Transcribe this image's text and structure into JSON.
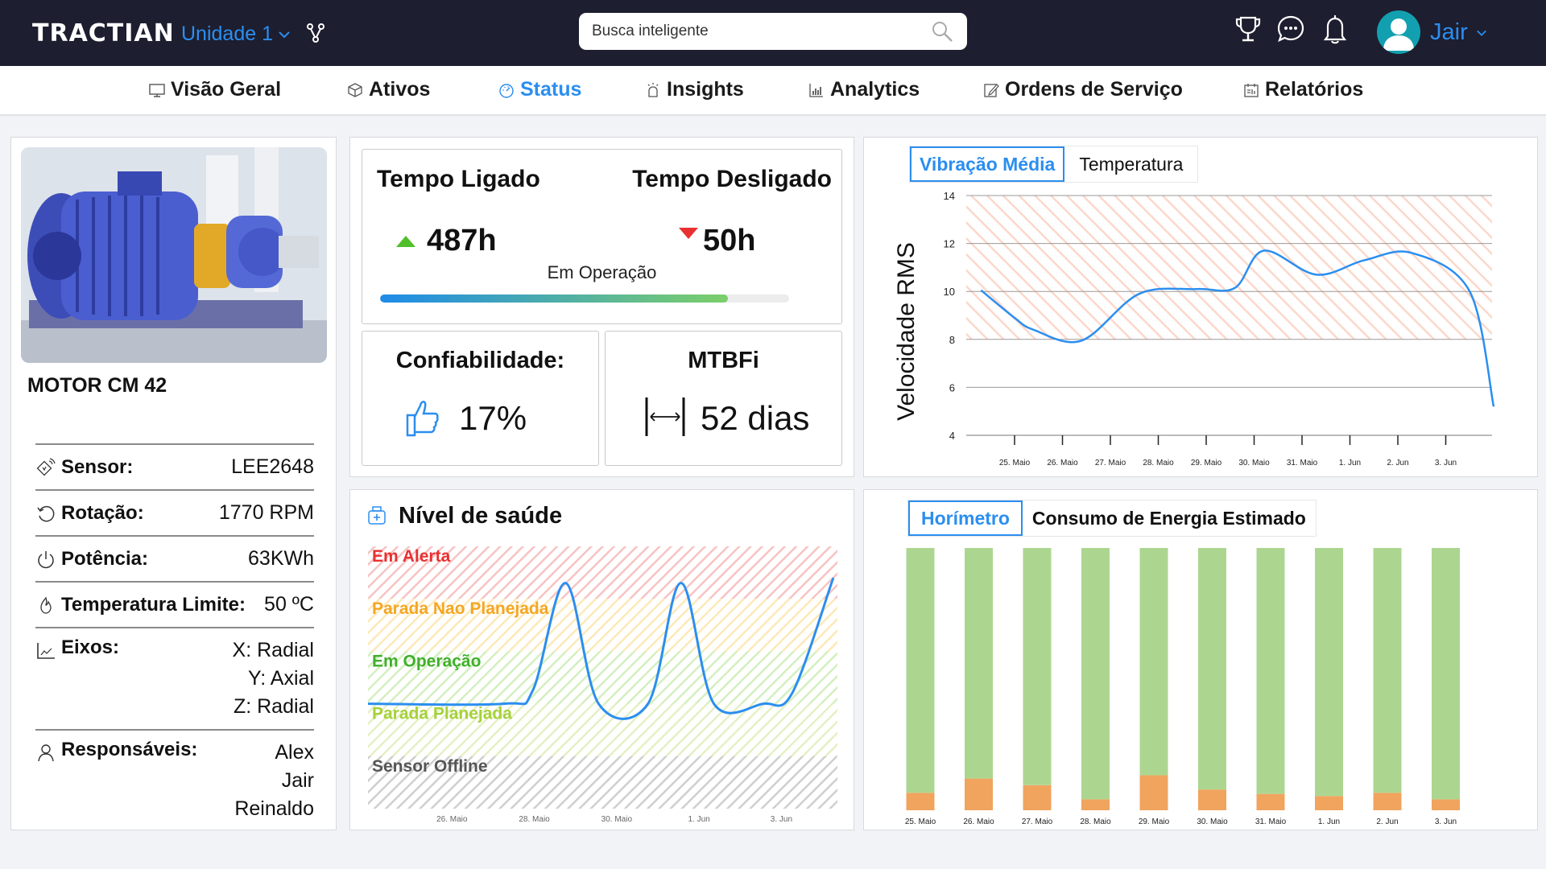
{
  "header": {
    "logo": "TRACTIAN",
    "unit_selector": "Unidade 1",
    "search_placeholder": "Busca inteligente",
    "user_name": "Jair"
  },
  "nav": {
    "items": [
      {
        "label": "Visão Geral",
        "icon": "monitor-icon",
        "active": false
      },
      {
        "label": "Ativos",
        "icon": "cube-icon",
        "active": false
      },
      {
        "label": "Status",
        "icon": "gauge-icon",
        "active": true
      },
      {
        "label": "Insights",
        "icon": "lightbulb-icon",
        "active": false
      },
      {
        "label": "Analytics",
        "icon": "bar-chart-icon",
        "active": false
      },
      {
        "label": "Ordens de Serviço",
        "icon": "edit-icon",
        "active": false
      },
      {
        "label": "Relatórios",
        "icon": "report-icon",
        "active": false
      }
    ]
  },
  "asset": {
    "name": "MOTOR CM 42",
    "specs": [
      {
        "label": "Sensor:",
        "icon": "sensor-icon",
        "values": [
          "LEE2648"
        ]
      },
      {
        "label": "Rotação:",
        "icon": "rotation-icon",
        "values": [
          "1770 RPM"
        ]
      },
      {
        "label": "Potência:",
        "icon": "power-icon",
        "values": [
          "63KWh"
        ]
      },
      {
        "label": "Temperatura Limite:",
        "icon": "flame-icon",
        "values": [
          "50 ºC"
        ]
      },
      {
        "label": "Eixos:",
        "icon": "axis-chart-icon",
        "values": [
          "X: Radial",
          "Y: Axial",
          "Z: Radial"
        ]
      },
      {
        "label": "Responsáveis:",
        "icon": "user-icon",
        "values": [
          "Alex",
          "Jair",
          "Reinaldo"
        ]
      }
    ]
  },
  "uptime": {
    "on_label": "Tempo Ligado",
    "on_value": "487h",
    "off_label": "Tempo Desligado",
    "off_value": "50h",
    "status": "Em Operação",
    "progress_fraction": 0.85,
    "colors": {
      "up": "#4fc02a",
      "down": "#e83131"
    }
  },
  "reliability": {
    "label": "Confiabilidade:",
    "value": "17%"
  },
  "mtbfi": {
    "label": "MTBFi",
    "value": "52 dias"
  },
  "vibration_tabs": [
    {
      "label": "Vibração Média",
      "active": true
    },
    {
      "label": "Temperatura",
      "active": false
    }
  ],
  "health": {
    "title": "Nível de saúde"
  },
  "energy_tabs": [
    {
      "label": "Horímetro",
      "active": true
    },
    {
      "label": "Consumo de Energia Estimado",
      "active": false
    }
  ],
  "chart_data": [
    {
      "type": "line",
      "title": "Vibração Média",
      "ylabel": "Velocidade RMS",
      "xlabel": "",
      "ylim": [
        4,
        14
      ],
      "yticks": [
        4,
        6,
        8,
        10,
        12,
        14
      ],
      "categories": [
        "25. Maio",
        "26. Maio",
        "27. Maio",
        "28. Maio",
        "29. Maio",
        "30. Maio",
        "31. Maio",
        "1. Jun",
        "2. Jun",
        "3. Jun"
      ],
      "alert_band": [
        8,
        14
      ],
      "series": [
        {
          "name": "Vibração Média",
          "color": "#2b8ef0",
          "x": [
            -0.7,
            0.0,
            0.4,
            1.4,
            2.6,
            3.8,
            4.6,
            5.2,
            6.3,
            7.3,
            8.3,
            9.5,
            10.0
          ],
          "values": [
            10.05,
            8.9,
            8.4,
            7.95,
            9.9,
            10.1,
            10.15,
            11.7,
            10.7,
            11.3,
            11.6,
            10.0,
            5.2
          ]
        }
      ],
      "grid": true
    },
    {
      "type": "line",
      "title": "Nível de saúde",
      "categories": [
        "26. Maio",
        "28. Maio",
        "30. Maio",
        "1. Jun",
        "3. Jun"
      ],
      "levels": [
        {
          "name": "Em Alerta",
          "color": "#e83131",
          "band": "#f7c3c3"
        },
        {
          "name": "Parada Nao Planejada",
          "color": "#f5a623",
          "band": "#fde9b8"
        },
        {
          "name": "Em Operação",
          "color": "#3fb02a",
          "band": "#d4efbf"
        },
        {
          "name": "Parada Planejada",
          "color": "#a6d13a",
          "band": "#e4f0c4"
        },
        {
          "name": "Sensor Offline",
          "color": "#555555",
          "band": "#cfcfcf"
        }
      ],
      "series": [
        {
          "name": "Saúde",
          "color": "#2b8ef0",
          "x": [
            24.0,
            27.3,
            28.0,
            28.8,
            29.6,
            30.8,
            31.6,
            32.4,
            33.6,
            34.3,
            35.3
          ],
          "values": [
            2.0,
            2.0,
            2.25,
            4.3,
            2.0,
            2.0,
            4.3,
            2.0,
            2.0,
            2.2,
            4.4
          ]
        }
      ]
    },
    {
      "type": "bar",
      "title": "Horímetro",
      "stacked": true,
      "categories": [
        "25. Maio",
        "26. Maio",
        "27. Maio",
        "28. Maio",
        "29. Maio",
        "30. Maio",
        "31. Maio",
        "1. Jun",
        "2. Jun",
        "3. Jun"
      ],
      "series": [
        {
          "name": "Desligado",
          "color": "#f0a45e",
          "values": [
            1.6,
            2.9,
            2.3,
            1.0,
            3.2,
            1.9,
            1.5,
            1.3,
            1.6,
            1.0
          ]
        },
        {
          "name": "Ligado",
          "color": "#acd690",
          "values": [
            22.4,
            21.1,
            21.7,
            23.0,
            20.8,
            22.1,
            22.5,
            22.7,
            22.4,
            23.0
          ]
        }
      ],
      "ylim": [
        0,
        24
      ]
    }
  ]
}
